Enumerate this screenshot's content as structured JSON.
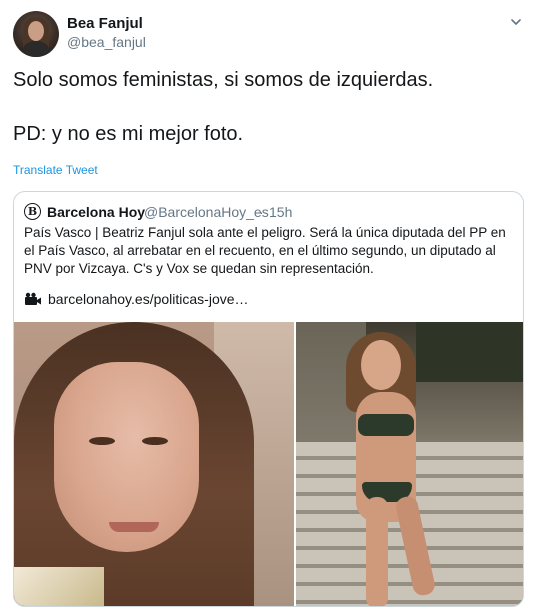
{
  "author": {
    "display_name": "Bea Fanjul",
    "handle": "@bea_fanjul"
  },
  "tweet": {
    "line1": "Solo somos feministas, si somos de izquierdas.",
    "line2": "PD: y no es mi mejor foto.",
    "translate_label": "Translate Tweet"
  },
  "quoted": {
    "logo_letter": "B",
    "name": "Barcelona Hoy",
    "handle": "@BarcelonaHoy_es",
    "separator": "·",
    "time": "15h",
    "text": "País Vasco | Beatriz Fanjul sola ante el peligro. Será la única diputada del PP en el País Vasco, al arrebatar en el recuento, en el último segundo, un diputado al PNV por Vizcaya. C's y Vox se quedan sin representación.",
    "link": "barcelonahoy.es/politicas-jove…"
  },
  "icons": {
    "caret": "chevron-down-icon",
    "link_prefix": "clapperboard-icon"
  },
  "colors": {
    "link_blue": "#1b95e0",
    "secondary_text": "#657786",
    "border": "#ccd6dd"
  }
}
